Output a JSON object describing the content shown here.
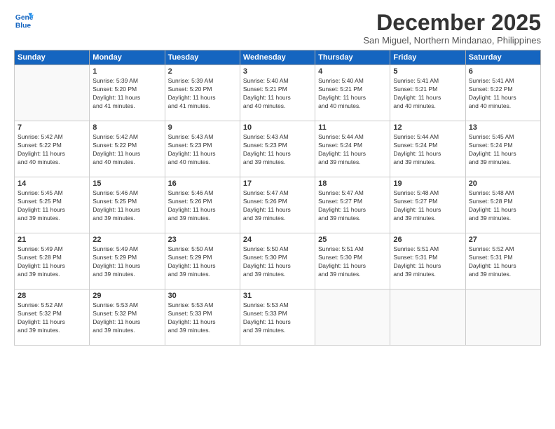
{
  "logo": {
    "line1": "General",
    "line2": "Blue"
  },
  "title": "December 2025",
  "location": "San Miguel, Northern Mindanao, Philippines",
  "header_days": [
    "Sunday",
    "Monday",
    "Tuesday",
    "Wednesday",
    "Thursday",
    "Friday",
    "Saturday"
  ],
  "weeks": [
    [
      {
        "day": "",
        "sunrise": "",
        "sunset": "",
        "daylight": ""
      },
      {
        "day": "1",
        "sunrise": "Sunrise: 5:39 AM",
        "sunset": "Sunset: 5:20 PM",
        "daylight": "Daylight: 11 hours and 41 minutes."
      },
      {
        "day": "2",
        "sunrise": "Sunrise: 5:39 AM",
        "sunset": "Sunset: 5:20 PM",
        "daylight": "Daylight: 11 hours and 41 minutes."
      },
      {
        "day": "3",
        "sunrise": "Sunrise: 5:40 AM",
        "sunset": "Sunset: 5:21 PM",
        "daylight": "Daylight: 11 hours and 40 minutes."
      },
      {
        "day": "4",
        "sunrise": "Sunrise: 5:40 AM",
        "sunset": "Sunset: 5:21 PM",
        "daylight": "Daylight: 11 hours and 40 minutes."
      },
      {
        "day": "5",
        "sunrise": "Sunrise: 5:41 AM",
        "sunset": "Sunset: 5:21 PM",
        "daylight": "Daylight: 11 hours and 40 minutes."
      },
      {
        "day": "6",
        "sunrise": "Sunrise: 5:41 AM",
        "sunset": "Sunset: 5:22 PM",
        "daylight": "Daylight: 11 hours and 40 minutes."
      }
    ],
    [
      {
        "day": "7",
        "sunrise": "Sunrise: 5:42 AM",
        "sunset": "Sunset: 5:22 PM",
        "daylight": "Daylight: 11 hours and 40 minutes."
      },
      {
        "day": "8",
        "sunrise": "Sunrise: 5:42 AM",
        "sunset": "Sunset: 5:22 PM",
        "daylight": "Daylight: 11 hours and 40 minutes."
      },
      {
        "day": "9",
        "sunrise": "Sunrise: 5:43 AM",
        "sunset": "Sunset: 5:23 PM",
        "daylight": "Daylight: 11 hours and 40 minutes."
      },
      {
        "day": "10",
        "sunrise": "Sunrise: 5:43 AM",
        "sunset": "Sunset: 5:23 PM",
        "daylight": "Daylight: 11 hours and 39 minutes."
      },
      {
        "day": "11",
        "sunrise": "Sunrise: 5:44 AM",
        "sunset": "Sunset: 5:24 PM",
        "daylight": "Daylight: 11 hours and 39 minutes."
      },
      {
        "day": "12",
        "sunrise": "Sunrise: 5:44 AM",
        "sunset": "Sunset: 5:24 PM",
        "daylight": "Daylight: 11 hours and 39 minutes."
      },
      {
        "day": "13",
        "sunrise": "Sunrise: 5:45 AM",
        "sunset": "Sunset: 5:24 PM",
        "daylight": "Daylight: 11 hours and 39 minutes."
      }
    ],
    [
      {
        "day": "14",
        "sunrise": "Sunrise: 5:45 AM",
        "sunset": "Sunset: 5:25 PM",
        "daylight": "Daylight: 11 hours and 39 minutes."
      },
      {
        "day": "15",
        "sunrise": "Sunrise: 5:46 AM",
        "sunset": "Sunset: 5:25 PM",
        "daylight": "Daylight: 11 hours and 39 minutes."
      },
      {
        "day": "16",
        "sunrise": "Sunrise: 5:46 AM",
        "sunset": "Sunset: 5:26 PM",
        "daylight": "Daylight: 11 hours and 39 minutes."
      },
      {
        "day": "17",
        "sunrise": "Sunrise: 5:47 AM",
        "sunset": "Sunset: 5:26 PM",
        "daylight": "Daylight: 11 hours and 39 minutes."
      },
      {
        "day": "18",
        "sunrise": "Sunrise: 5:47 AM",
        "sunset": "Sunset: 5:27 PM",
        "daylight": "Daylight: 11 hours and 39 minutes."
      },
      {
        "day": "19",
        "sunrise": "Sunrise: 5:48 AM",
        "sunset": "Sunset: 5:27 PM",
        "daylight": "Daylight: 11 hours and 39 minutes."
      },
      {
        "day": "20",
        "sunrise": "Sunrise: 5:48 AM",
        "sunset": "Sunset: 5:28 PM",
        "daylight": "Daylight: 11 hours and 39 minutes."
      }
    ],
    [
      {
        "day": "21",
        "sunrise": "Sunrise: 5:49 AM",
        "sunset": "Sunset: 5:28 PM",
        "daylight": "Daylight: 11 hours and 39 minutes."
      },
      {
        "day": "22",
        "sunrise": "Sunrise: 5:49 AM",
        "sunset": "Sunset: 5:29 PM",
        "daylight": "Daylight: 11 hours and 39 minutes."
      },
      {
        "day": "23",
        "sunrise": "Sunrise: 5:50 AM",
        "sunset": "Sunset: 5:29 PM",
        "daylight": "Daylight: 11 hours and 39 minutes."
      },
      {
        "day": "24",
        "sunrise": "Sunrise: 5:50 AM",
        "sunset": "Sunset: 5:30 PM",
        "daylight": "Daylight: 11 hours and 39 minutes."
      },
      {
        "day": "25",
        "sunrise": "Sunrise: 5:51 AM",
        "sunset": "Sunset: 5:30 PM",
        "daylight": "Daylight: 11 hours and 39 minutes."
      },
      {
        "day": "26",
        "sunrise": "Sunrise: 5:51 AM",
        "sunset": "Sunset: 5:31 PM",
        "daylight": "Daylight: 11 hours and 39 minutes."
      },
      {
        "day": "27",
        "sunrise": "Sunrise: 5:52 AM",
        "sunset": "Sunset: 5:31 PM",
        "daylight": "Daylight: 11 hours and 39 minutes."
      }
    ],
    [
      {
        "day": "28",
        "sunrise": "Sunrise: 5:52 AM",
        "sunset": "Sunset: 5:32 PM",
        "daylight": "Daylight: 11 hours and 39 minutes."
      },
      {
        "day": "29",
        "sunrise": "Sunrise: 5:53 AM",
        "sunset": "Sunset: 5:32 PM",
        "daylight": "Daylight: 11 hours and 39 minutes."
      },
      {
        "day": "30",
        "sunrise": "Sunrise: 5:53 AM",
        "sunset": "Sunset: 5:33 PM",
        "daylight": "Daylight: 11 hours and 39 minutes."
      },
      {
        "day": "31",
        "sunrise": "Sunrise: 5:53 AM",
        "sunset": "Sunset: 5:33 PM",
        "daylight": "Daylight: 11 hours and 39 minutes."
      },
      {
        "day": "",
        "sunrise": "",
        "sunset": "",
        "daylight": ""
      },
      {
        "day": "",
        "sunrise": "",
        "sunset": "",
        "daylight": ""
      },
      {
        "day": "",
        "sunrise": "",
        "sunset": "",
        "daylight": ""
      }
    ]
  ]
}
